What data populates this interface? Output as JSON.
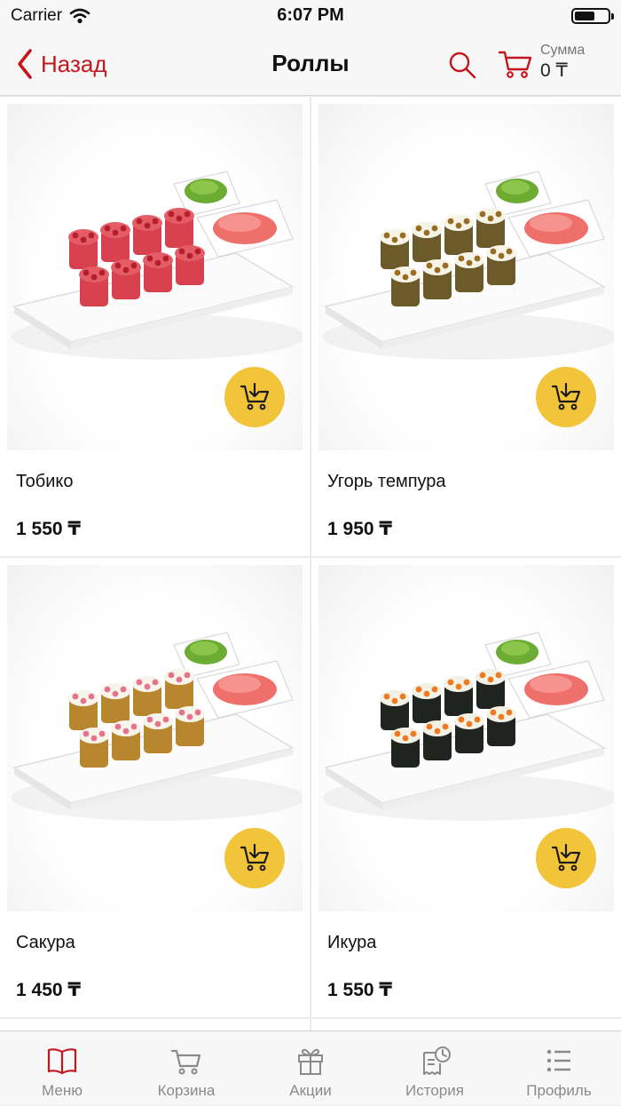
{
  "status": {
    "carrier": "Carrier",
    "time": "6:07 PM"
  },
  "header": {
    "back_label": "Назад",
    "title": "Роллы",
    "sum_label": "Сумма",
    "sum_value": "0 ₸"
  },
  "products": [
    {
      "name": "Тобико",
      "price": "1 550 ₸",
      "roll_type": "tobiko"
    },
    {
      "name": "Угорь темпура",
      "price": "1 950 ₸",
      "roll_type": "tempura"
    },
    {
      "name": "Сакура",
      "price": "1 450 ₸",
      "roll_type": "sakura"
    },
    {
      "name": "Икура",
      "price": "1 550 ₸",
      "roll_type": "ikura"
    }
  ],
  "tabs": [
    {
      "label": "Меню",
      "icon": "book-icon",
      "active": true
    },
    {
      "label": "Корзина",
      "icon": "cart-icon",
      "active": false
    },
    {
      "label": "Акции",
      "icon": "gift-icon",
      "active": false
    },
    {
      "label": "История",
      "icon": "receipt-clock-icon",
      "active": false
    },
    {
      "label": "Профиль",
      "icon": "list-icon",
      "active": false
    }
  ],
  "colors": {
    "accent": "#c4161c",
    "button_yellow": "#f2c43a",
    "inactive_tab": "#8a8a8a"
  }
}
